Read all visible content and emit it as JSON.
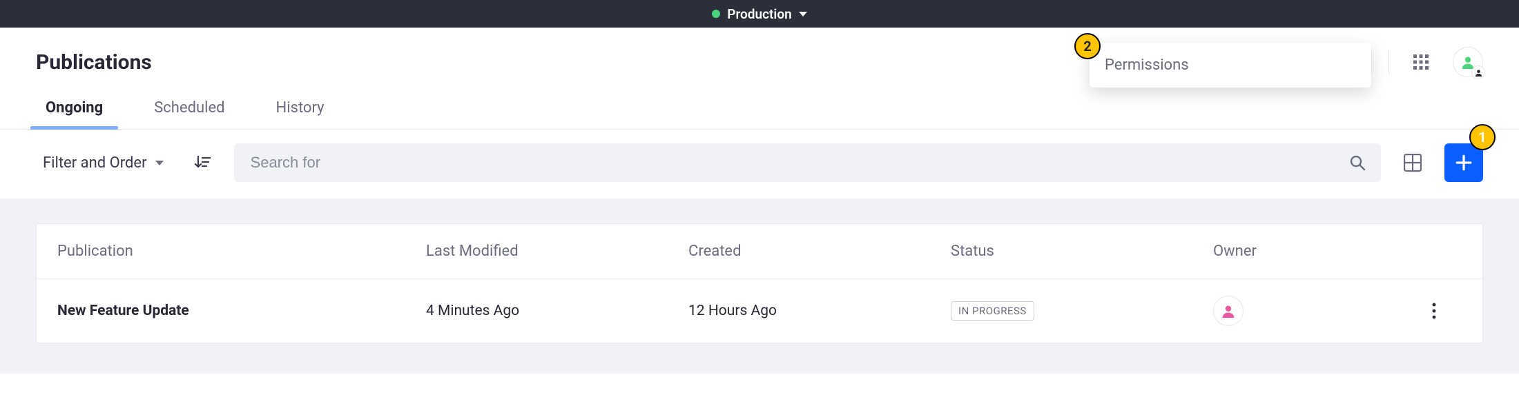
{
  "env": {
    "label": "Production"
  },
  "header": {
    "title": "Publications",
    "dropdown": {
      "permissions_label": "Permissions"
    }
  },
  "tabs": [
    {
      "label": "Ongoing",
      "active": true
    },
    {
      "label": "Scheduled",
      "active": false
    },
    {
      "label": "History",
      "active": false
    }
  ],
  "toolbar": {
    "filter_order_label": "Filter and Order",
    "search_placeholder": "Search for"
  },
  "table": {
    "columns": {
      "publication": "Publication",
      "last_modified": "Last Modified",
      "created": "Created",
      "status": "Status",
      "owner": "Owner"
    },
    "rows": [
      {
        "name": "New Feature Update",
        "last_modified": "4 Minutes Ago",
        "created": "12 Hours Ago",
        "status": "IN PROGRESS"
      }
    ]
  },
  "callouts": {
    "one": "1",
    "two": "2"
  },
  "colors": {
    "accent": "#0b5fff",
    "badge": "#ffc400",
    "env_dot": "#4bd37b"
  }
}
